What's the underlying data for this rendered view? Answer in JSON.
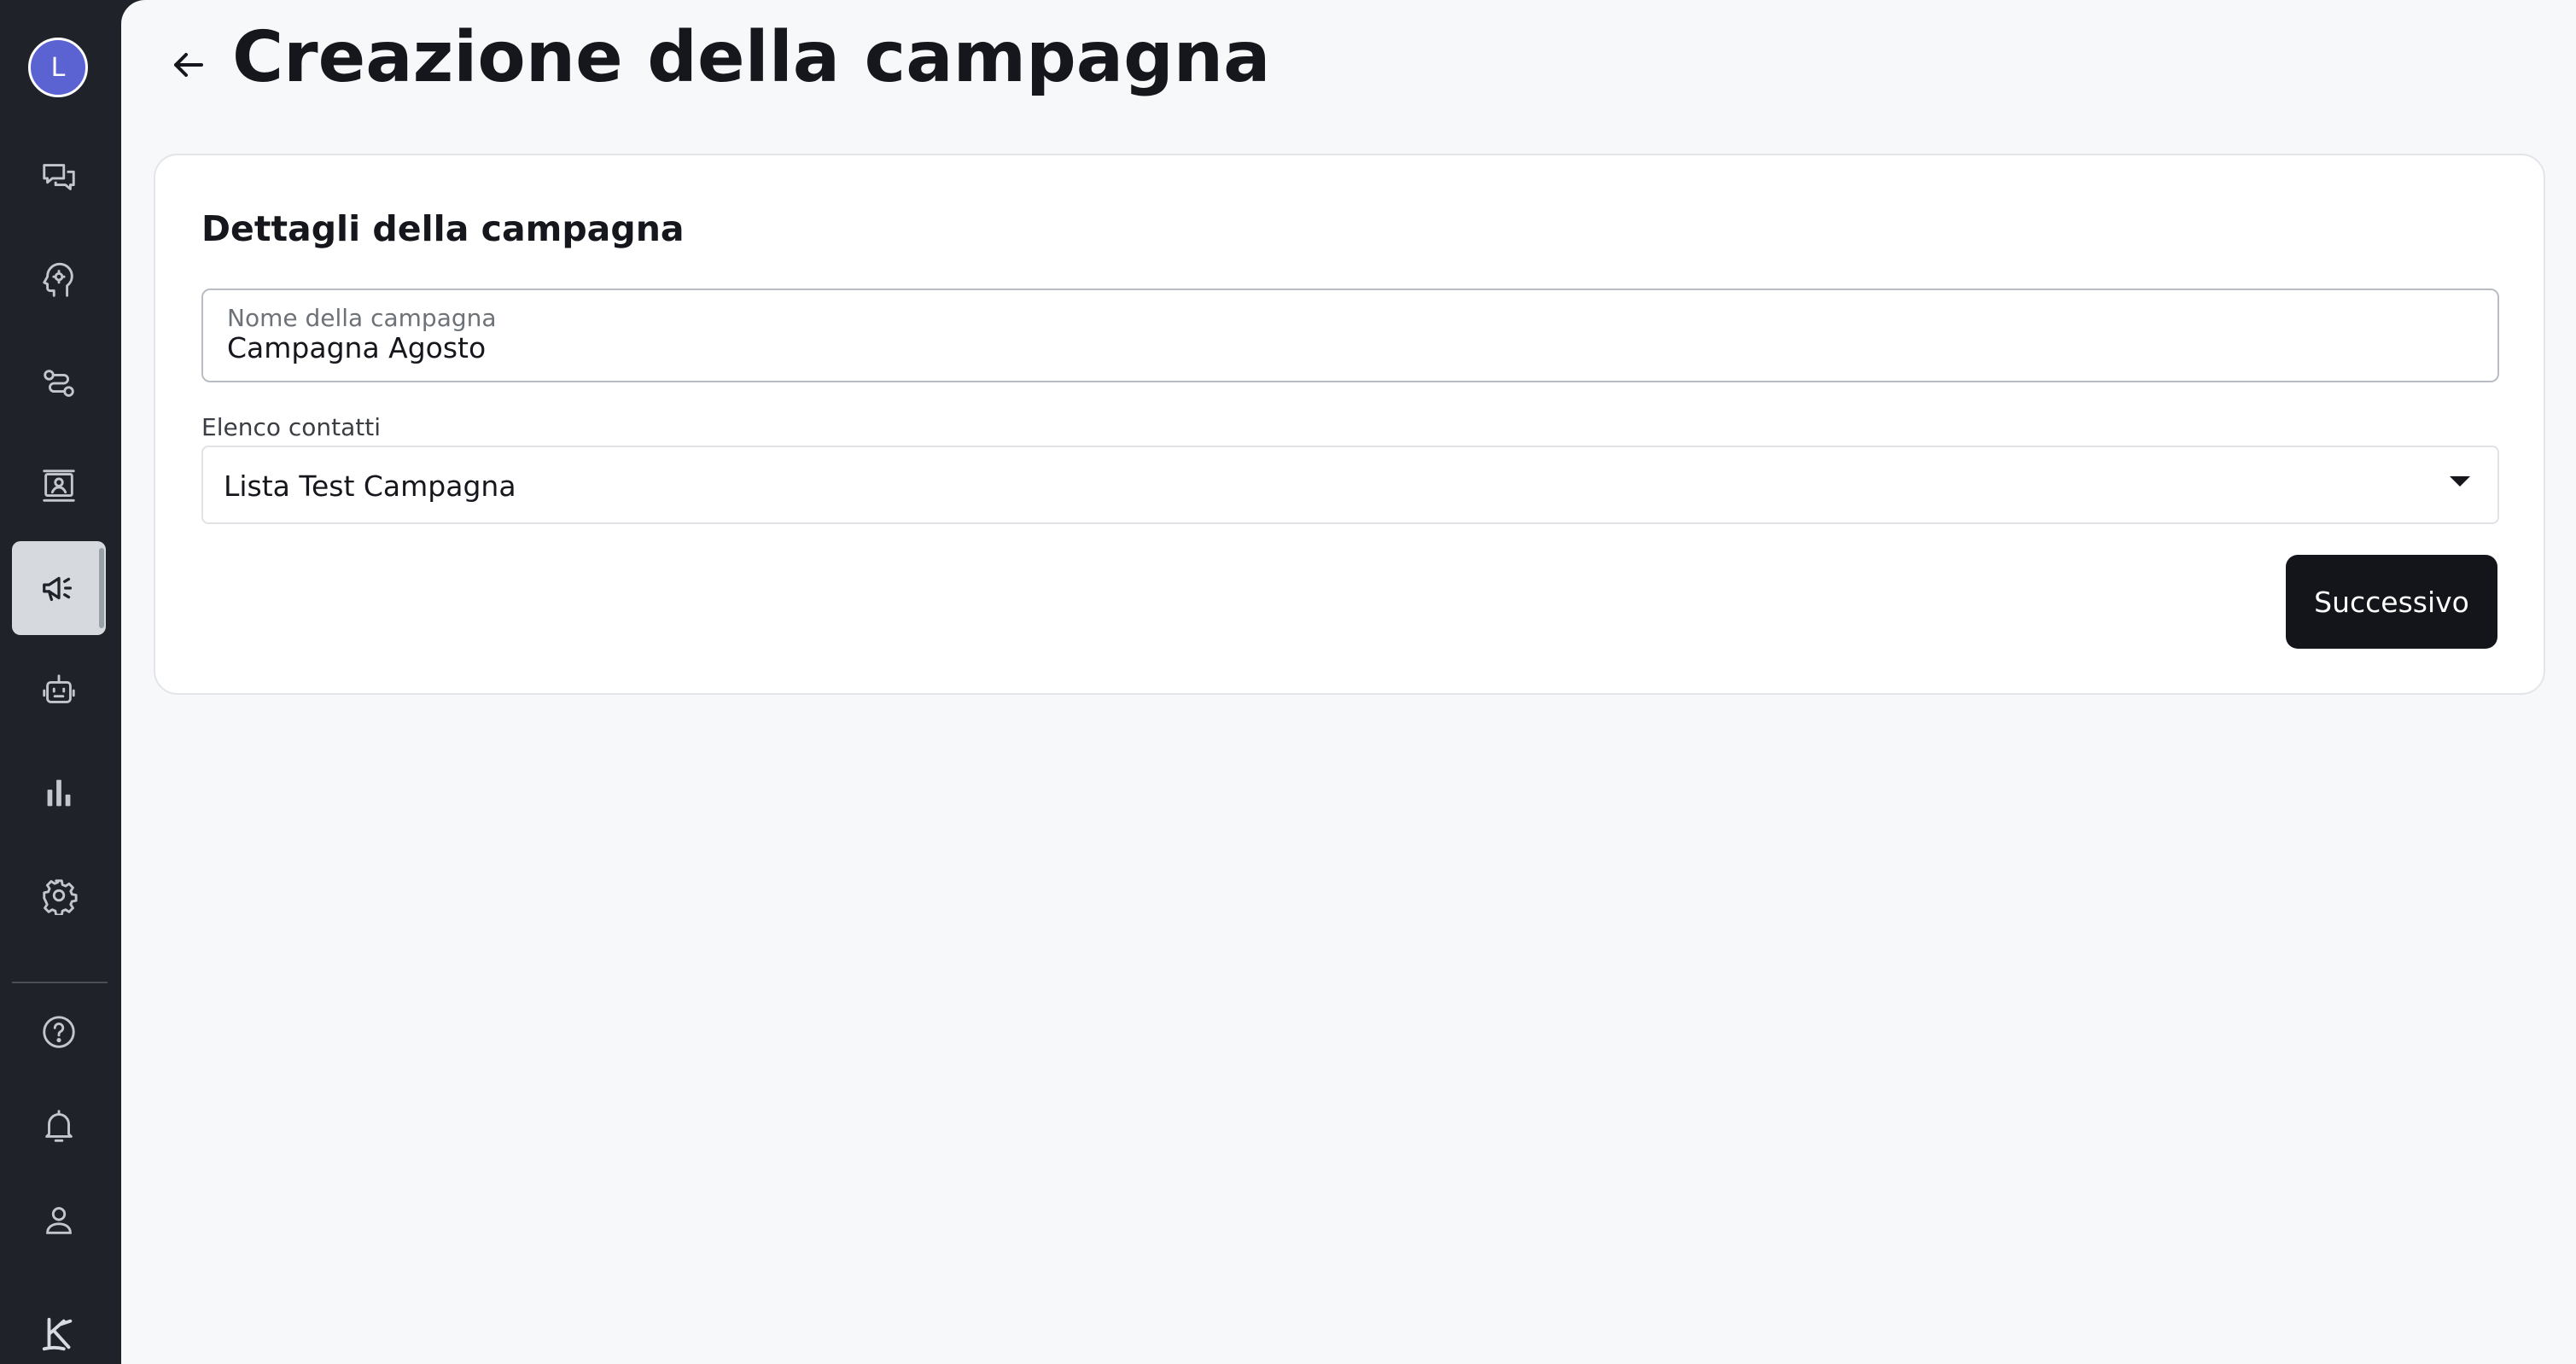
{
  "sidebar": {
    "avatar_initial": "L",
    "items": [
      {
        "icon": "chat-icon"
      },
      {
        "icon": "head-gear-icon"
      },
      {
        "icon": "route-icon"
      },
      {
        "icon": "contact-card-icon"
      },
      {
        "icon": "megaphone-icon",
        "active": true
      },
      {
        "icon": "bot-icon"
      },
      {
        "icon": "bar-chart-icon"
      },
      {
        "icon": "gear-icon"
      }
    ],
    "bottom_items": [
      {
        "icon": "help-icon"
      },
      {
        "icon": "bell-icon"
      },
      {
        "icon": "user-icon"
      },
      {
        "icon": "logo-icon"
      }
    ]
  },
  "header": {
    "title": "Creazione della campagna"
  },
  "card": {
    "title": "Dettagli della campagna",
    "name_field": {
      "label": "Nome della campagna",
      "value": "Campagna Agosto"
    },
    "contacts_field": {
      "label": "Elenco contatti",
      "value": "Lista Test Campagna"
    },
    "next_label": "Successivo"
  },
  "colors": {
    "sidebar_bg": "#1f2229",
    "main_bg": "#f7f8fa",
    "avatar_bg": "#5b63d3",
    "primary_button": "#13151a"
  }
}
